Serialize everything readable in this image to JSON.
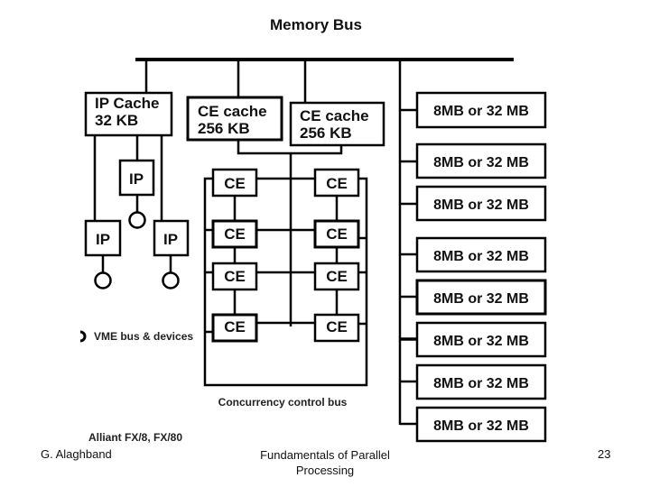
{
  "diagram": {
    "title": "Memory Bus",
    "ip_cache": {
      "line1": "IP Cache",
      "line2": "32 KB"
    },
    "ce_caches": [
      {
        "line1": "CE cache",
        "line2": "256 KB"
      },
      {
        "line1": "CE cache",
        "line2": "256 KB"
      }
    ],
    "memory_modules": [
      "8MB or 32 MB",
      "8MB or 32 MB",
      "8MB or 32 MB",
      "8MB or 32 MB",
      "8MB or 32 MB",
      "8MB or 32 MB",
      "8MB or 32 MB",
      "8MB or 32 MB"
    ],
    "ip_processors": [
      "IP",
      "IP",
      "IP"
    ],
    "ce_processors": [
      "CE",
      "CE",
      "CE",
      "CE",
      "CE",
      "CE",
      "CE",
      "CE"
    ],
    "vme_legend": "VME bus & devices",
    "concurrency_bus_label": "Concurrency control bus",
    "caption": "Alliant FX/8, FX/80"
  },
  "footer": {
    "author": "G. Alaghband",
    "course_line1": "Fundamentals of Parallel",
    "course_line2": "Processing",
    "page_number": "23"
  }
}
